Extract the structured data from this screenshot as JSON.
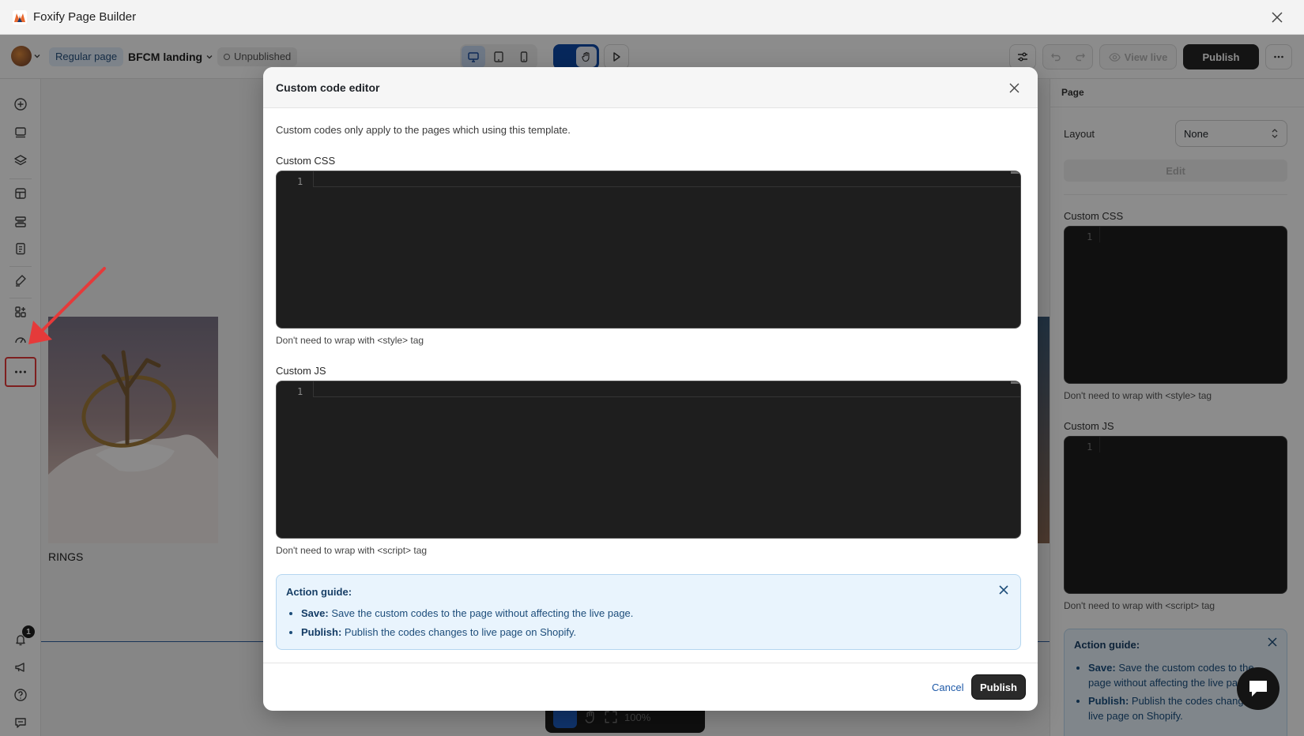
{
  "window": {
    "title": "Foxify Page Builder"
  },
  "toolbar": {
    "page_type": "Regular page",
    "page_name": "BFCM landing",
    "status": "Unpublished",
    "view_live_label": "View live",
    "publish_label": "Publish"
  },
  "canvas": {
    "product_label": "RINGS",
    "zoom": "100%"
  },
  "right_panel": {
    "header": "Page",
    "layout_label": "Layout",
    "layout_value": "None",
    "edit_label": "Edit",
    "css_label": "Custom CSS",
    "css_line": "1",
    "css_hint": "Don't need to wrap with <style> tag",
    "js_label": "Custom JS",
    "js_line": "1",
    "js_hint": "Don't need to wrap with <script> tag",
    "guide_title": "Action guide:",
    "guide_save_key": "Save:",
    "guide_save_text": "Save the custom codes to the page without affecting the live page.",
    "guide_publish_key": "Publish:",
    "guide_publish_text": "Publish the codes changes to live page on Shopify."
  },
  "rail": {
    "notification_count": "1"
  },
  "modal": {
    "title": "Custom code editor",
    "description": "Custom codes only apply to the pages which using this template.",
    "css_label": "Custom CSS",
    "css_line": "1",
    "css_hint": "Don't need to wrap with <style> tag",
    "js_label": "Custom JS",
    "js_line": "1",
    "js_hint": "Don't need to wrap with <script> tag",
    "guide": {
      "title": "Action guide:",
      "items": [
        {
          "key": "Save:",
          "text": "Save the custom codes to the page without affecting the live page."
        },
        {
          "key": "Publish:",
          "text": "Publish the codes changes to live page on Shopify."
        }
      ]
    },
    "cancel_label": "Cancel",
    "publish_label": "Publish"
  },
  "colors": {
    "accent_blue": "#0e49a8",
    "code_bg": "#1e1e1e",
    "guide_bg": "#e9f4fd",
    "annotation_red": "#e53a3a"
  }
}
